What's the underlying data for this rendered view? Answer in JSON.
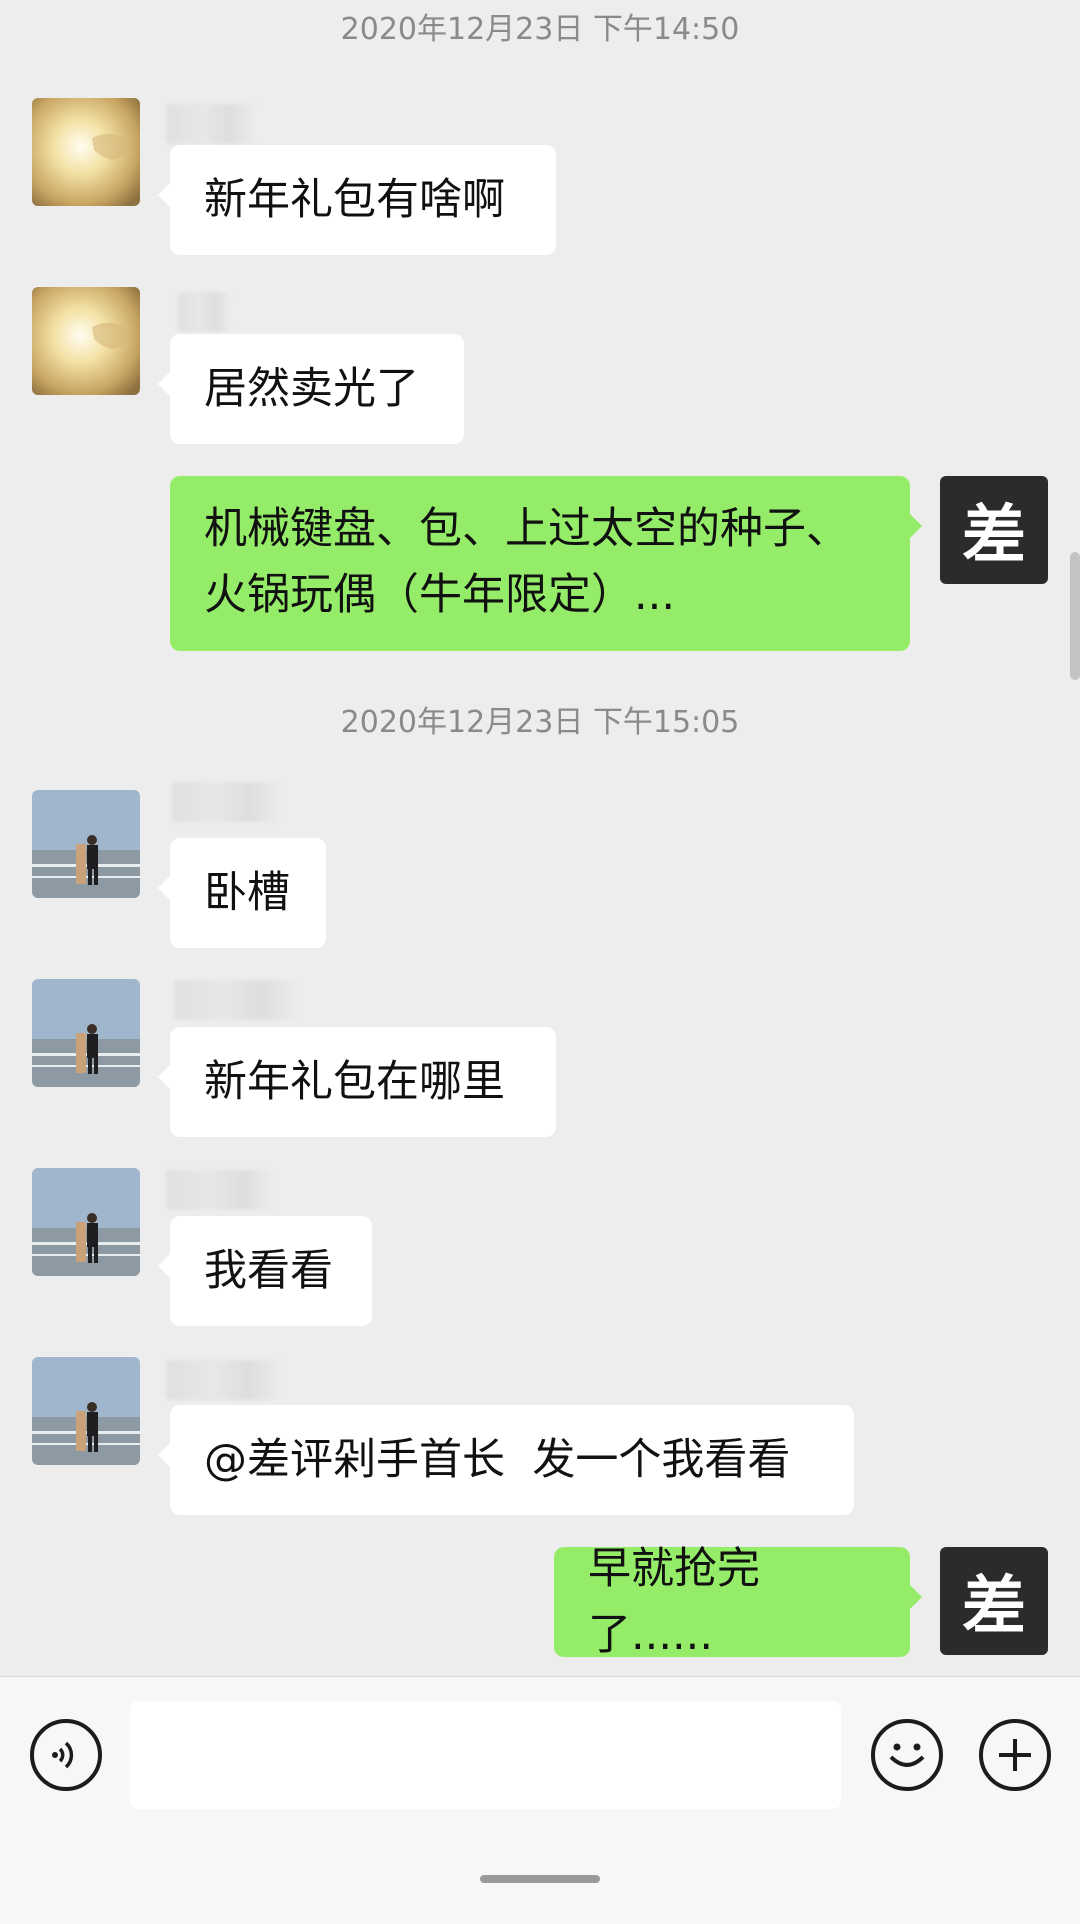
{
  "chat": {
    "timestamps": [
      "2020年12月23日 下午14:50",
      "2020年12月23日 下午15:05"
    ],
    "messages": [
      {
        "side": "in",
        "avatar": "sun-hand-avatar",
        "text": "新年礼包有啥啊"
      },
      {
        "side": "in",
        "avatar": "sun-hand-avatar",
        "text": "居然卖光了"
      },
      {
        "side": "out",
        "avatar": "cha-logo-avatar",
        "text": "机械键盘、包、上过太空的种子、\n火锅玩偶（牛年限定）..."
      },
      {
        "side": "in",
        "avatar": "man-photo-avatar",
        "text": "卧槽"
      },
      {
        "side": "in",
        "avatar": "man-photo-avatar",
        "text": "新年礼包在哪里"
      },
      {
        "side": "in",
        "avatar": "man-photo-avatar",
        "text": "我看看"
      },
      {
        "side": "in",
        "avatar": "man-photo-avatar",
        "text": "@差评剁手首长  发一个我看看"
      },
      {
        "side": "out",
        "avatar": "cha-logo-avatar",
        "text": "早就抢完了......"
      }
    ],
    "self_avatar_char": "差"
  },
  "input_bar": {
    "voice_icon": "voice-icon",
    "emoji_icon": "emoji-icon",
    "plus_icon": "plus-icon",
    "input_value": ""
  },
  "colors": {
    "background": "#ededed",
    "incoming_bubble": "#ffffff",
    "outgoing_bubble": "#95ec69",
    "self_avatar_bg": "#2b2b2b"
  }
}
